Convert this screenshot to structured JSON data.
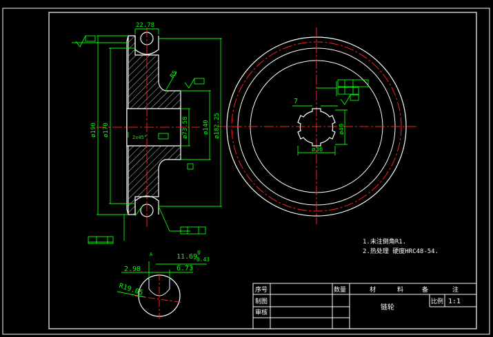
{
  "colors": {
    "background": "#000000",
    "frame": "#ffffff",
    "outline": "#ffffff",
    "dimension": "#00ff00",
    "center": "#ff2020",
    "pitch": "#ff2020",
    "hatch": "#ffffff",
    "text": "#ffffff"
  },
  "dimensions": {
    "d_190": "ø190",
    "d_170": "ø170",
    "d_73_58": "ø73.58",
    "d_140": "ø140",
    "d_182_25": "ø182.25",
    "w_22_78": "22.78",
    "r_5": "R5",
    "chamfer": "2x45°",
    "spline_7": "7",
    "spline_40": "ø40",
    "spline_36": "ø36",
    "detail_11_69": "11.69",
    "detail_tol_upper": "0",
    "detail_tol_lower": "-0.43",
    "detail_2_98": "2.98",
    "detail_6_73": "6.73",
    "detail_r19_05": "R19.05",
    "detail_label": "A"
  },
  "notes": {
    "line1": "1.未注倒角R1.",
    "line2": "2.热处理 硬度HRC48-54."
  },
  "title_block": {
    "h_no": "序号",
    "h_qty": "数量",
    "h_mat1": "材",
    "h_mat2": "料",
    "h_rem1": "备",
    "h_rem2": "注",
    "drawn": "制图",
    "checked": "审核",
    "part_name": "链轮",
    "scale_label": "比例",
    "scale_value": "1:1"
  }
}
